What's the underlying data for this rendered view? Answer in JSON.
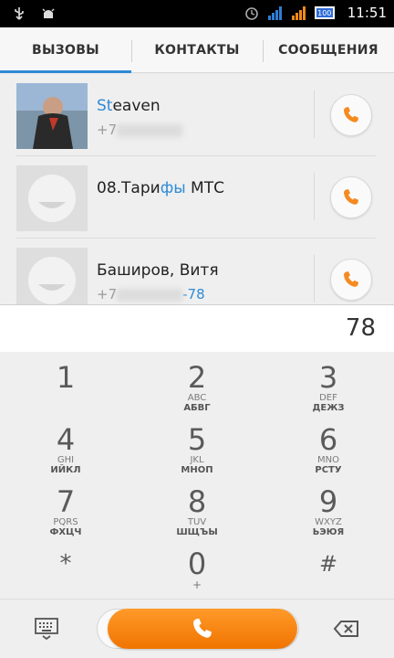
{
  "status_bar": {
    "time": "11:51",
    "battery": "100",
    "icons": [
      "usb-icon",
      "android-debug-icon",
      "alarm-icon",
      "signal-blue-icon",
      "signal-orange-icon",
      "battery-icon"
    ]
  },
  "tabs": [
    {
      "label": "ВЫЗОВЫ",
      "active": true
    },
    {
      "label": "КОНТАКТЫ",
      "active": false
    },
    {
      "label": "СООБЩЕНИЯ",
      "active": false
    }
  ],
  "contacts": [
    {
      "name_hl": "St",
      "name_rest": "eaven",
      "number_prefix": "+7",
      "number_suffix": ""
    },
    {
      "name_pre": "08.Тари",
      "name_hl": "фы",
      "name_post": " МТС"
    },
    {
      "name": "Баширов, Витя",
      "number_prefix": "+7",
      "number_suffix": "-78"
    }
  ],
  "dialer": {
    "value": "78",
    "keys": [
      {
        "digit": "1",
        "latin": "",
        "cyr": ""
      },
      {
        "digit": "2",
        "latin": "ABC",
        "cyr": "АБВГ"
      },
      {
        "digit": "3",
        "latin": "DEF",
        "cyr": "ДЕЖЗ"
      },
      {
        "digit": "4",
        "latin": "GHI",
        "cyr": "ИЙКЛ"
      },
      {
        "digit": "5",
        "latin": "JKL",
        "cyr": "МНОП"
      },
      {
        "digit": "6",
        "latin": "MNO",
        "cyr": "РСТУ"
      },
      {
        "digit": "7",
        "latin": "PQRS",
        "cyr": "ФХЦЧ"
      },
      {
        "digit": "8",
        "latin": "TUV",
        "cyr": "ШЩЪЫ"
      },
      {
        "digit": "9",
        "latin": "WXYZ",
        "cyr": "ЬЭЮЯ"
      },
      {
        "digit": "*",
        "latin": "",
        "cyr": ""
      },
      {
        "digit": "0",
        "latin": "+",
        "cyr": ""
      },
      {
        "digit": "#",
        "latin": "",
        "cyr": ""
      }
    ]
  },
  "colors": {
    "accent": "#2e8bd6",
    "call_orange": "#f58a1f"
  }
}
